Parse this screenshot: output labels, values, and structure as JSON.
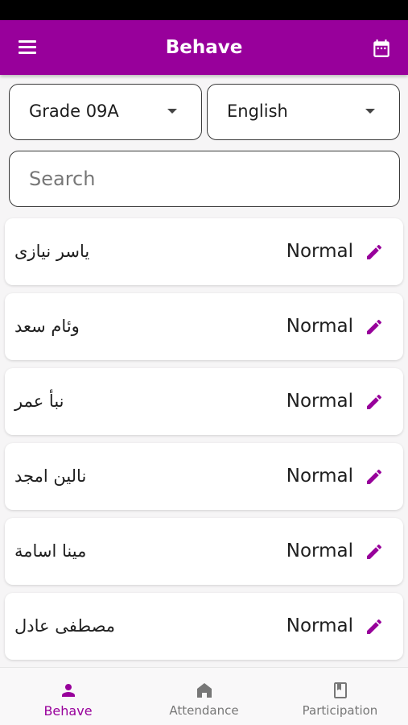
{
  "app": {
    "title": "Behave",
    "accent_color": "#98009b",
    "menu_icon": "hamburger-menu-icon",
    "calendar_icon": "calendar-icon"
  },
  "filters": {
    "grade": {
      "selected": "Grade 09A"
    },
    "subject": {
      "selected": "English"
    }
  },
  "search": {
    "placeholder": "Search",
    "value": ""
  },
  "students": [
    {
      "name": "ياسر نيازى",
      "status": "Normal"
    },
    {
      "name": "وئام سعد",
      "status": "Normal"
    },
    {
      "name": "نبأ عمر",
      "status": "Normal"
    },
    {
      "name": "نالين  امجد",
      "status": "Normal"
    },
    {
      "name": "مينا اسامة",
      "status": "Normal"
    },
    {
      "name": "مصطفى عادل",
      "status": "Normal"
    }
  ],
  "bottom_nav": {
    "items": [
      {
        "label": "Behave",
        "icon": "person-icon",
        "active": true
      },
      {
        "label": "Attendance",
        "icon": "home-icon",
        "active": false
      },
      {
        "label": "Participation",
        "icon": "book-icon",
        "active": false
      }
    ]
  }
}
